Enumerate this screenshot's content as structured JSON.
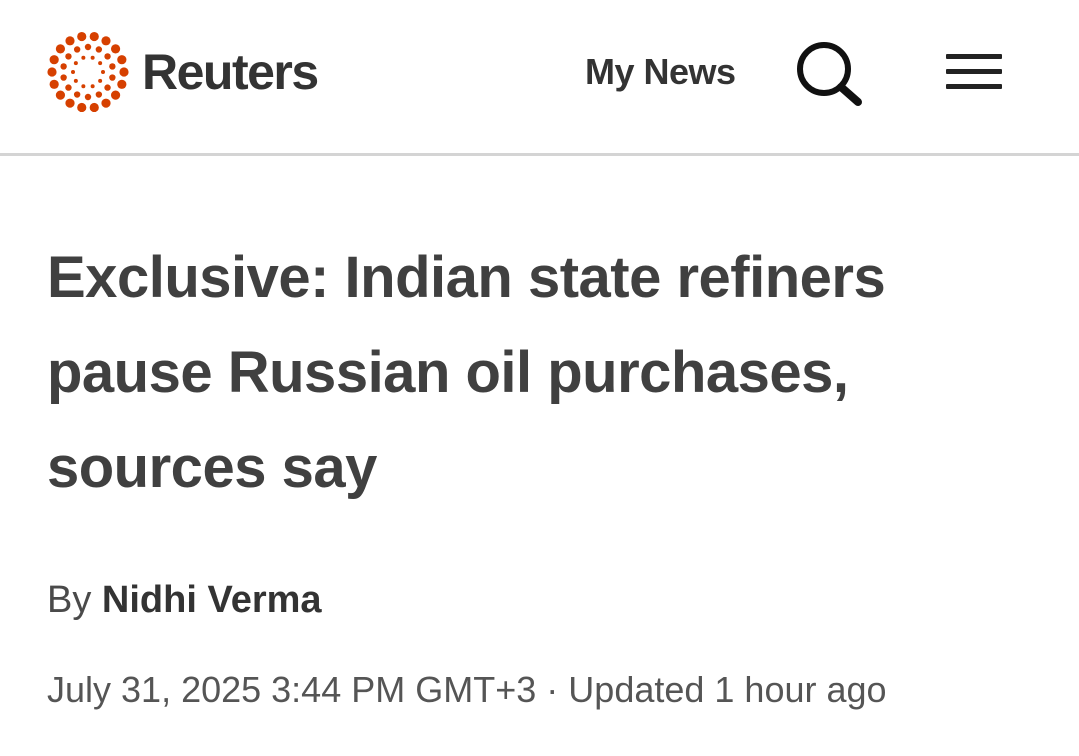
{
  "header": {
    "brand": "Reuters",
    "logo_icon": "reuters-dot-ring-icon",
    "nav_link": "My News",
    "search_icon": "search-icon",
    "menu_icon": "hamburger-menu-icon",
    "logo_color": "#d64000"
  },
  "article": {
    "headline": "Exclusive: Indian state refiners pause Russian oil purchases, sources say",
    "byline_prefix": "By",
    "author": "Nidhi Verma",
    "published": "July 31, 2025 3:44 PM GMT+3",
    "separator": "·",
    "updated": "Updated 1 hour ago"
  }
}
